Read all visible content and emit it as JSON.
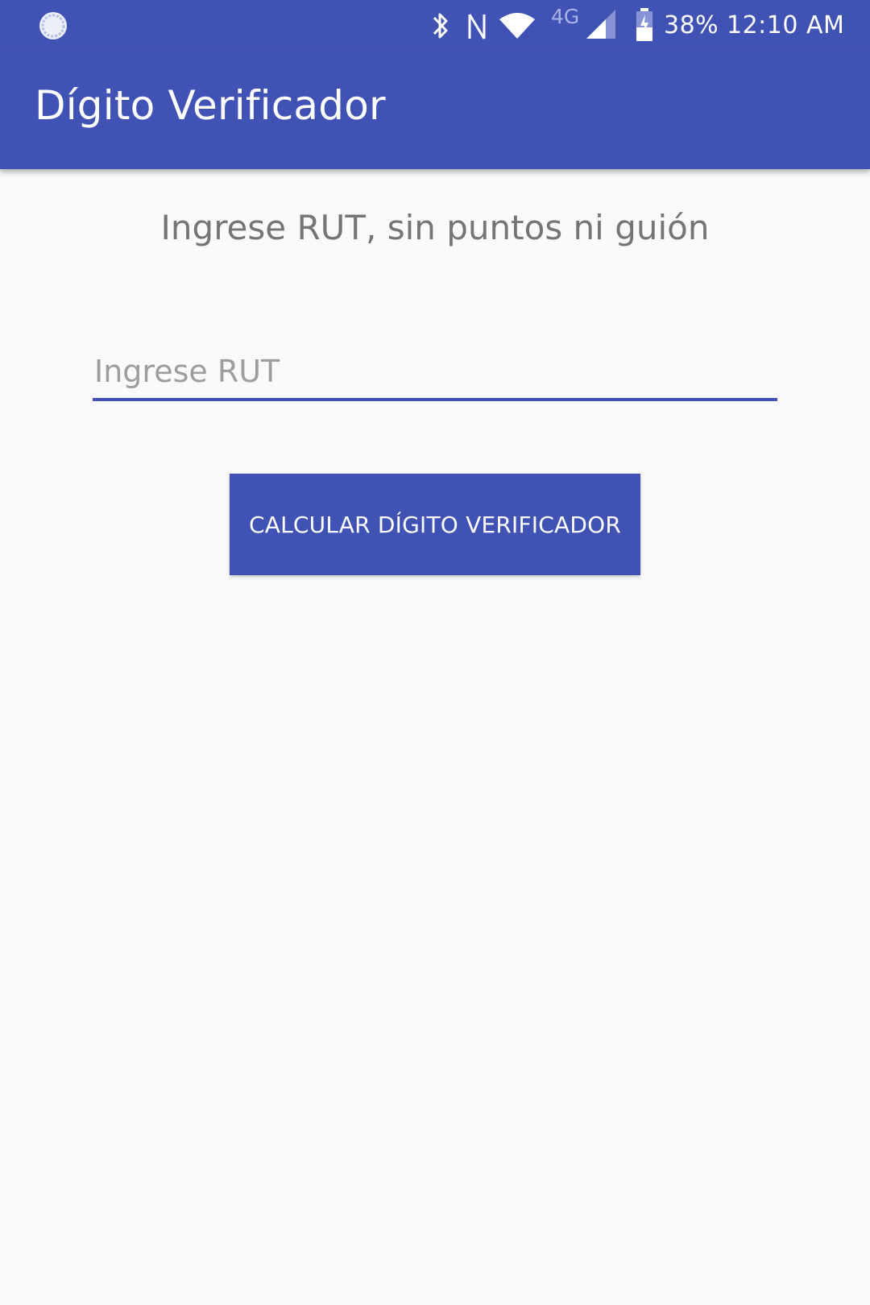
{
  "status_bar": {
    "network_type": "4G",
    "battery_percent": "38%",
    "time": "12:10 AM",
    "icons": [
      "sync-icon",
      "bluetooth-icon",
      "nfc-icon",
      "wifi-icon",
      "cell-signal-icon",
      "battery-charging-icon"
    ]
  },
  "toolbar": {
    "title": "Dígito Verificador"
  },
  "main": {
    "instruction": "Ingrese RUT, sin puntos ni guión",
    "rut_input": {
      "placeholder": "Ingrese RUT",
      "value": ""
    },
    "calculate_button_label": "CALCULAR DÍGITO VERIFICADOR"
  },
  "colors": {
    "primary": "#4152b5",
    "background": "#fafafa",
    "secondary_text": "#757575",
    "hint_text": "#9e9e9e"
  }
}
